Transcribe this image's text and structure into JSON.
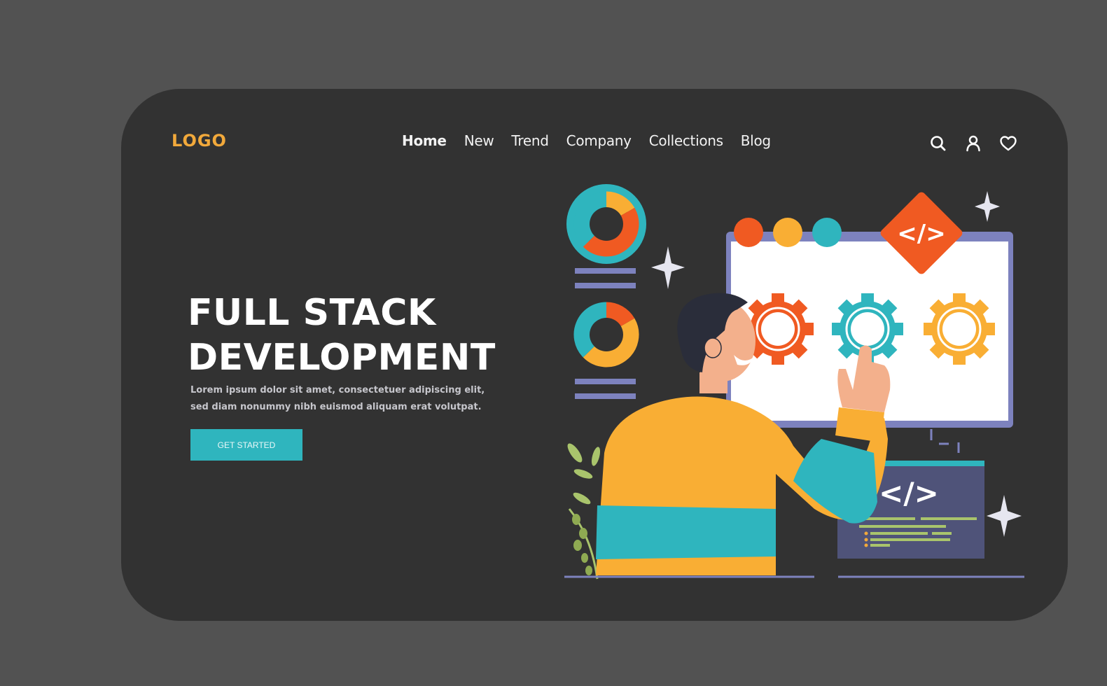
{
  "header": {
    "logo": "LOGO",
    "nav": [
      {
        "label": "Home",
        "active": true
      },
      {
        "label": "New",
        "active": false
      },
      {
        "label": "Trend",
        "active": false
      },
      {
        "label": "Company",
        "active": false
      },
      {
        "label": "Collections",
        "active": false
      },
      {
        "label": "Blog",
        "active": false
      }
    ],
    "icons": [
      "search-icon",
      "user-icon",
      "heart-icon"
    ]
  },
  "hero": {
    "title_line1": "FULL STACK",
    "title_line2": "DEVELOPMENT",
    "description": "Lorem ipsum dolor sit amet, consectetuer adipiscing elit, sed diam nonummy nibh euismod aliquam erat volutpat.",
    "cta_label": "GET STARTED"
  },
  "illustration": {
    "code_badge": "</>",
    "code_window_label": "</>",
    "gears": [
      "orange",
      "teal",
      "yellow"
    ],
    "browser_dots": [
      "orange",
      "yellow",
      "teal"
    ]
  },
  "colors": {
    "background": "#525252",
    "card": "#323232",
    "logo": "#F2A93B",
    "accent_teal": "#2FB5BE",
    "accent_orange": "#F05A22",
    "accent_yellow": "#F9AE34",
    "monitor_frame": "#7D82BE",
    "code_panel": "#4F5379",
    "code_lines": "#A9C46C"
  }
}
